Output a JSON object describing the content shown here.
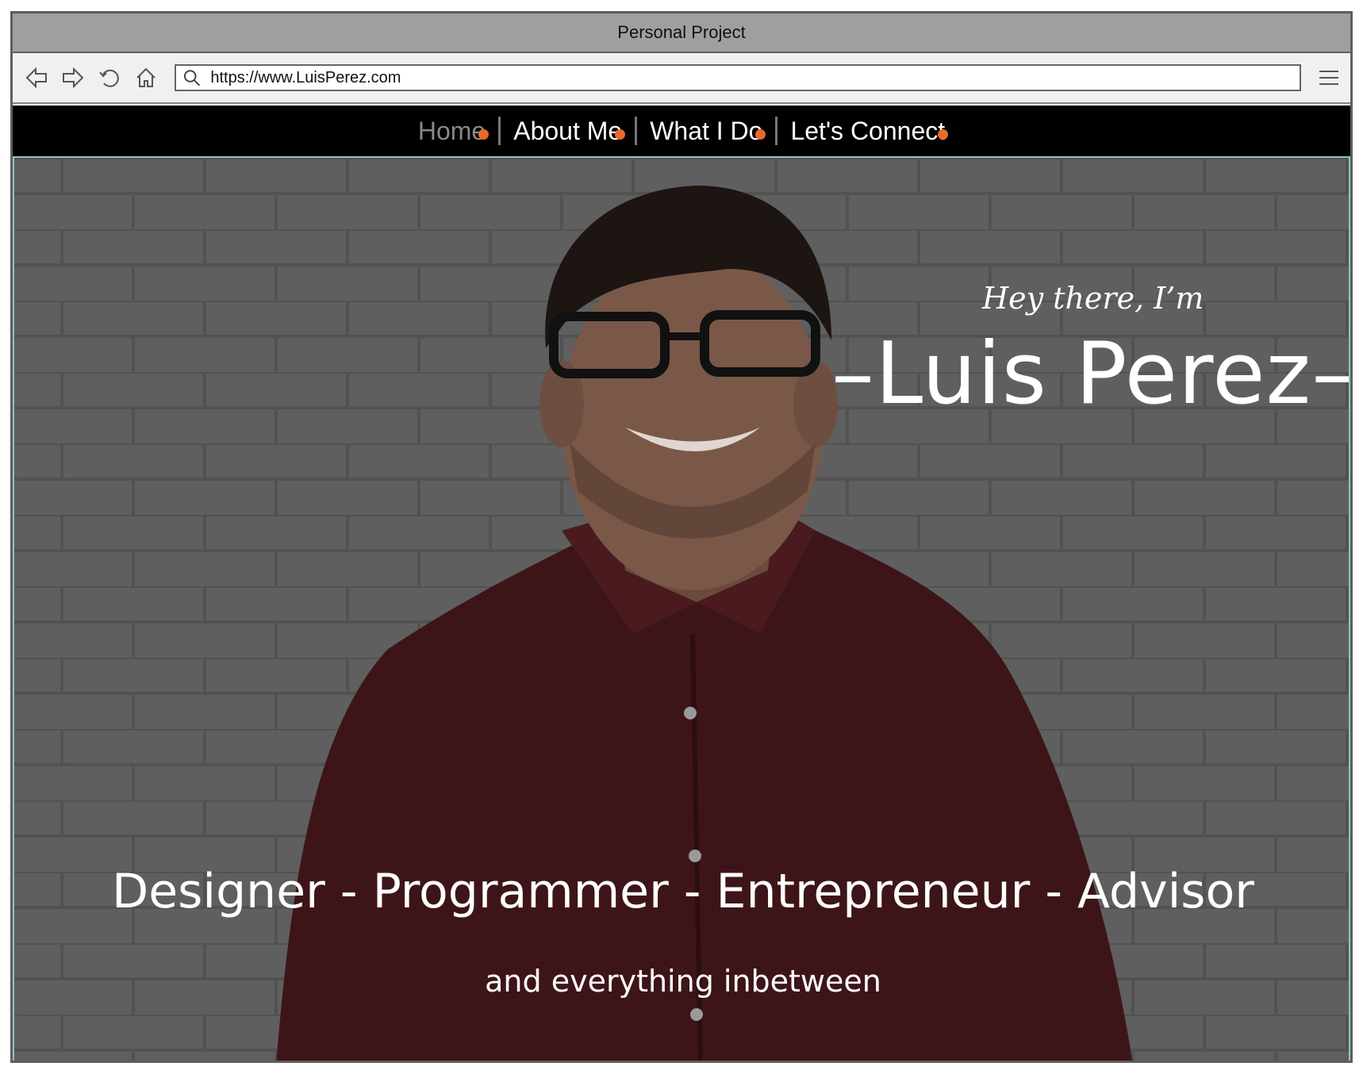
{
  "window": {
    "title": "Personal Project"
  },
  "toolbar": {
    "back_icon": "back-arrow-icon",
    "forward_icon": "forward-arrow-icon",
    "reload_icon": "reload-icon",
    "home_icon": "home-icon",
    "search_icon": "search-icon",
    "menu_icon": "hamburger-menu-icon",
    "url": "https://www.LuisPerez.com"
  },
  "site_nav": {
    "items": [
      {
        "label": "Home",
        "active": true
      },
      {
        "label": "About Me",
        "active": false
      },
      {
        "label": "What I Do",
        "active": false
      },
      {
        "label": "Let's Connect",
        "active": false
      }
    ],
    "accent_color": "#e86a2b"
  },
  "hero": {
    "greeting": "Hey there, I’m",
    "name": "–Luis Perez–",
    "roles": "Designer - Programmer - Entrepreneur - Advisor",
    "tagline": "and everything inbetween",
    "image": "portrait-photo"
  }
}
